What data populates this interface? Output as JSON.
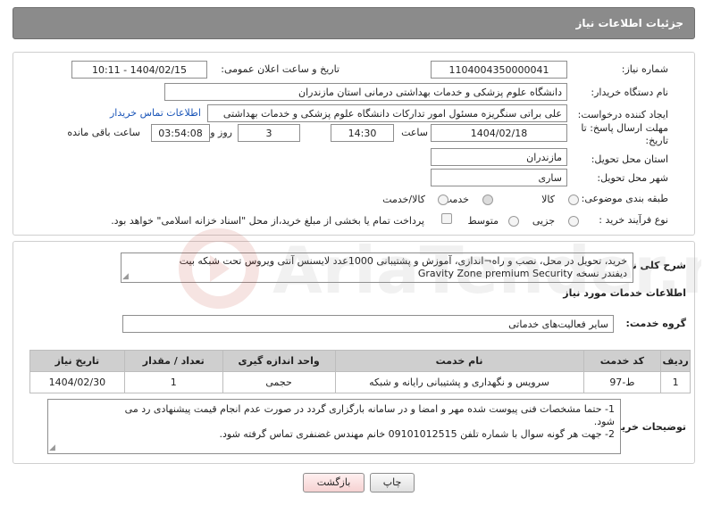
{
  "header": {
    "title": "جزئیات اطلاعات نیاز"
  },
  "need_number": {
    "label": "شماره نیاز:",
    "value": "1104004350000041"
  },
  "announce_datetime": {
    "label": "تاریخ و ساعت اعلان عمومی:",
    "value": "1404/02/15 - 10:11"
  },
  "buyer_org": {
    "label": "نام دستگاه خریدار:",
    "value": "دانشگاه علوم پزشکی و خدمات بهداشتی  درمانی استان مازندران"
  },
  "requester": {
    "label": "ایجاد کننده درخواست:",
    "value": "علی براتی سنگریزه مسئول امور تدارکات دانشگاه علوم پزشکی و خدمات بهداشتی",
    "contact_link": "اطلاعات تماس خریدار"
  },
  "deadline": {
    "label_line1": "مهلت ارسال پاسخ: تا",
    "label_line2": "تاریخ:",
    "date": "1404/02/18",
    "time_label": "ساعت",
    "time": "14:30",
    "days": "3",
    "days_label": "روز و",
    "remaining": "03:54:08",
    "remaining_label": "ساعت باقی مانده"
  },
  "province": {
    "label": "استان محل تحویل:",
    "value": "مازندران"
  },
  "city": {
    "label": "شهر محل تحویل:",
    "value": "ساری"
  },
  "category": {
    "label": "طبقه بندی موضوعی:",
    "options": [
      "کالا",
      "خدمت",
      "کالا/خدمت"
    ],
    "selected": "خدمت"
  },
  "purchase_type": {
    "label": "نوع فرآیند خرید :",
    "options": [
      "جزیی",
      "متوسط"
    ],
    "selected": "",
    "treasury_note": "پرداخت تمام یا بخشی از مبلغ خرید،از محل \"اسناد خزانه اسلامی\" خواهد بود."
  },
  "description": {
    "label": "شرح کلی نیاز:",
    "line1": "خرید،  تحویل در محل، نصب و راه¬اندازی، آموزش و پشتیبانی 1000عدد لایسنس آنتی ویروس تحت شبکه بیت",
    "line2_fa": "دیفندر نسخه",
    "line2_en": "Gravity Zone premium Security"
  },
  "services_section": {
    "title": "اطلاعات خدمات مورد نیاز"
  },
  "service_group": {
    "label": "گروه خدمت:",
    "value": "سایر فعالیت‌های خدماتی"
  },
  "services_table": {
    "headers": [
      "ردیف",
      "کد خدمت",
      "نام خدمت",
      "واحد اندازه گیری",
      "تعداد / مقدار",
      "تاریخ نیاز"
    ],
    "rows": [
      [
        "1",
        "ط-97",
        "سرویس و نگهداری و پشتیبانی رایانه و شبکه",
        "حجمی",
        "1",
        "1404/02/30"
      ]
    ]
  },
  "buyer_notes": {
    "label": "توضیحات خریدار:",
    "line1": "1- حتما مشخصات فنی پیوست شده مهر و امضا و در سامانه بارگزاری گردد در صورت عدم انجام قیمت پیشنهادی رد می",
    "line2": "شود.",
    "line3": "2- جهت هر گونه سوال با شماره تلفن 09101012515 خانم مهندس غضنفری تماس گرفته شود."
  },
  "buttons": {
    "print": "چاپ",
    "back": "بازگشت"
  },
  "watermark": {
    "text": "AriaTender.net"
  },
  "colors": {
    "header_bg": "#8b8b8b",
    "link": "#1a55b8",
    "table_header": "#cfcfcf",
    "back_button_bg": "#fde2e2"
  }
}
